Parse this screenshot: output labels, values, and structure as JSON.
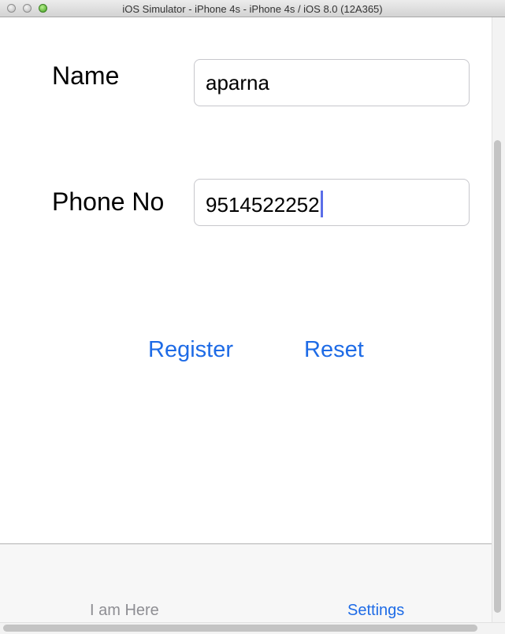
{
  "window": {
    "title": "iOS Simulator - iPhone 4s - iPhone 4s / iOS 8.0 (12A365)"
  },
  "form": {
    "name_label": "Name",
    "name_value": "aparna",
    "phone_label": "Phone No",
    "phone_value": "9514522252"
  },
  "actions": {
    "register_label": "Register",
    "reset_label": "Reset"
  },
  "tabs": [
    {
      "label": "I am Here",
      "selected": false
    },
    {
      "label": "Settings",
      "selected": true
    }
  ],
  "colors": {
    "accent": "#1e6be6",
    "tab_inactive": "#8e8e93",
    "caret": "#5b6ee8"
  }
}
